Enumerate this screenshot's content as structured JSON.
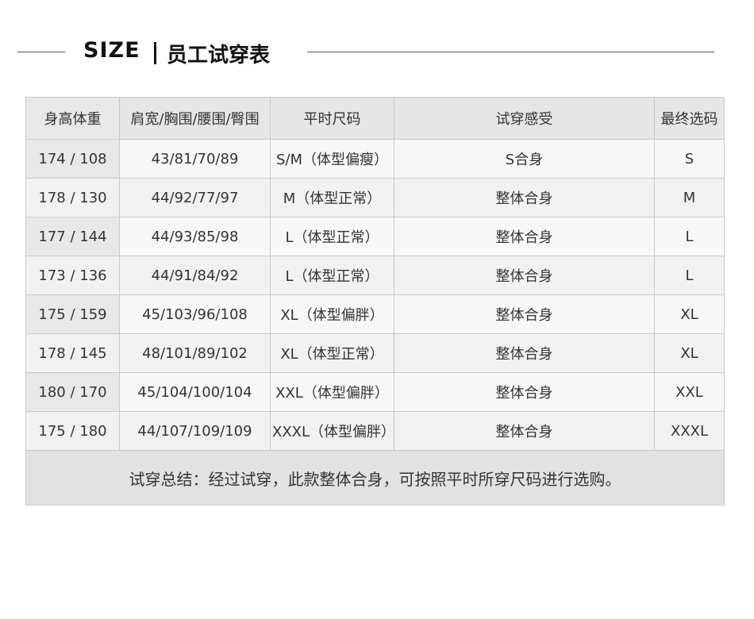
{
  "title": {
    "size_word": "SIZE",
    "cn_title": "员工试穿表"
  },
  "table": {
    "headers": [
      "身高体重",
      "肩宽/胸围/腰围/臀围",
      "平时尺码",
      "试穿感受",
      "最终选码"
    ],
    "rows": [
      [
        "174 / 108",
        "43/81/70/89",
        "S/M（体型偏瘦）",
        "S合身",
        "S"
      ],
      [
        "178 / 130",
        "44/92/77/97",
        "M（体型正常）",
        "整体合身",
        "M"
      ],
      [
        "177 / 144",
        "44/93/85/98",
        "L（体型正常）",
        "整体合身",
        "L"
      ],
      [
        "173 / 136",
        "44/91/84/92",
        "L（体型正常）",
        "整体合身",
        "L"
      ],
      [
        "175 / 159",
        "45/103/96/108",
        "XL（体型偏胖）",
        "整体合身",
        "XL"
      ],
      [
        "178 / 145",
        "48/101/89/102",
        "XL（体型正常）",
        "整体合身",
        "XL"
      ],
      [
        "180 / 170",
        "45/104/100/104",
        "XXL（体型偏胖）",
        "整体合身",
        "XXL"
      ],
      [
        "175 / 180",
        "44/107/109/109",
        "XXXL（体型偏胖）",
        "整体合身",
        "XXXL"
      ]
    ],
    "summary": "试穿总结：经过试穿，此款整体合身，可按照平时所穿尺码进行选购。"
  }
}
